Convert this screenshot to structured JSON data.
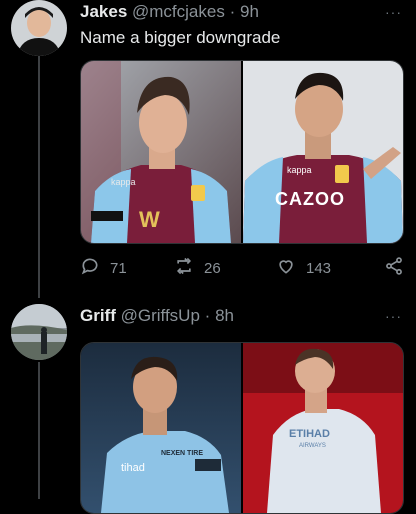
{
  "tweets": [
    {
      "name": "Jakes",
      "handle": "@mcfcjakes",
      "sep": "·",
      "time": "9h",
      "text": "Name a bigger downgrade",
      "more": "···",
      "image_left_text": {
        "sponsor": "W",
        "brand": "kappa"
      },
      "image_right_text": {
        "sponsor": "CAZOO",
        "brand": "kappa"
      },
      "actions": {
        "replies": "71",
        "retweets": "26",
        "likes": "143"
      }
    },
    {
      "name": "Griff",
      "handle": "@GriffsUp",
      "sep": "·",
      "time": "8h",
      "more": "···",
      "image_left_text": {
        "sponsor": "NEXEN TIRE",
        "chest": "tihad"
      },
      "image_right_text": {
        "sponsor": "ETIHAD",
        "sub": "AIRWAYS"
      }
    }
  ],
  "colors": {
    "background": "#000000",
    "text": "#e7e9ea",
    "muted": "#8b9298",
    "villa_claret": "#7a1e3a",
    "villa_blue": "#8cc7ea",
    "city_blue": "#8ec3e6",
    "city_white": "#dfe6ee"
  }
}
